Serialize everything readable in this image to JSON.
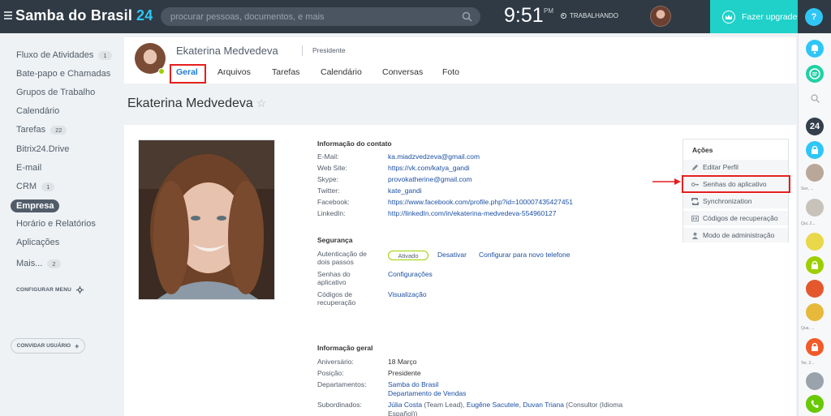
{
  "header": {
    "brand": "Samba do Brasil",
    "brand_number": "24",
    "search_placeholder": "procurar pessoas, documentos, e mais",
    "clock_time": "9:51",
    "clock_ampm": "PM",
    "work_status": "TRABALHANDO",
    "upgrade_label": "Fazer upgrade",
    "help_label": "?"
  },
  "sidebar": {
    "items": [
      {
        "label": "Fluxo de Atividades",
        "badge": "1"
      },
      {
        "label": "Bate-papo e Chamadas"
      },
      {
        "label": "Grupos de Trabalho"
      },
      {
        "label": "Calendário"
      },
      {
        "label": "Tarefas",
        "badge": "22"
      },
      {
        "label": "Bitrix24.Drive"
      },
      {
        "label": "E-mail"
      },
      {
        "label": "CRM",
        "badge": "1"
      },
      {
        "label": "Empresa",
        "active": true
      },
      {
        "label": "Horário e Relatórios"
      },
      {
        "label": "Aplicações"
      },
      {
        "label": "Mais...",
        "badge": "2"
      }
    ],
    "configure_menu": "CONFIGURAR MENU",
    "invite_user": "CONVIDAR USUÁRIO"
  },
  "profile": {
    "name": "Ekaterina Medvedeva",
    "role": "Presidente",
    "tabs": [
      "Geral",
      "Arquivos",
      "Tarefas",
      "Calendário",
      "Conversas",
      "Foto"
    ],
    "active_tab": "Geral",
    "title": "Ekaterina Medvedeva",
    "star": "☆"
  },
  "contact": {
    "section_title": "Informação do contato",
    "rows": [
      {
        "label": "E-Mail:",
        "value": "ka.miadzvedzeva@gmail.com"
      },
      {
        "label": "Web Site:",
        "value": "https://vk.com/katya_gandi"
      },
      {
        "label": "Skype:",
        "value": "provokatherine@gmail.com"
      },
      {
        "label": "Twitter:",
        "value": "kate_gandi"
      },
      {
        "label": "Facebook:",
        "value": "https://www.facebook.com/profile.php?id=100007435427451"
      },
      {
        "label": "LinkedIn:",
        "value": "http://linkedIn.com/in/ekaterina-medvedeva-554960127"
      }
    ]
  },
  "security": {
    "section_title": "Segurança",
    "twofa_label_1": "Autenticação de",
    "twofa_label_2": "dois passos",
    "twofa_status": "Ativado",
    "deactivate": "Desativar",
    "configure_phone": "Configurar para novo telefone",
    "app_pw_label_1": "Senhas do",
    "app_pw_label_2": "aplicativo",
    "app_pw_link": "Configurações",
    "recovery_label_1": "Códigos de",
    "recovery_label_2": "recuperação",
    "recovery_link": "Visualização"
  },
  "general": {
    "section_title": "Informação geral",
    "birthday_label": "Aniversário:",
    "birthday": "18 Março",
    "position_label": "Posição:",
    "position": "Presidente",
    "departments_label": "Departamentos:",
    "dept_1": "Samba do Brasil",
    "dept_2": "Departamento de Vendas",
    "subordinates_label": "Subordinados:",
    "sub_1": "Júlia Costa",
    "sub_1_role": " (Team Lead), ",
    "sub_2": "Eugêne Sacutele",
    "sub_sep": ", ",
    "sub_3": "Duvan Triana",
    "sub_3_role": " (Consultor (Idioma",
    "sub_3_role_2": "Español))"
  },
  "actions": {
    "title": "Ações",
    "items": [
      "Editar Perfil",
      "Senhas do aplicativo",
      "Synchronization",
      "Códigos de recuperação",
      "Modo de administração"
    ]
  },
  "rail": {
    "captions": [
      "Sex, ...",
      "Qui, 2...",
      "Qua, ...",
      "Ter, 2..."
    ],
    "badge_24": "24"
  },
  "colors": {
    "topbar": "#2f3a44",
    "accent": "#2fc6f6",
    "upgrade": "#1fd1c9",
    "link": "#1c50a3",
    "highlight": "#e41f1f",
    "online": "#9dcf00"
  }
}
